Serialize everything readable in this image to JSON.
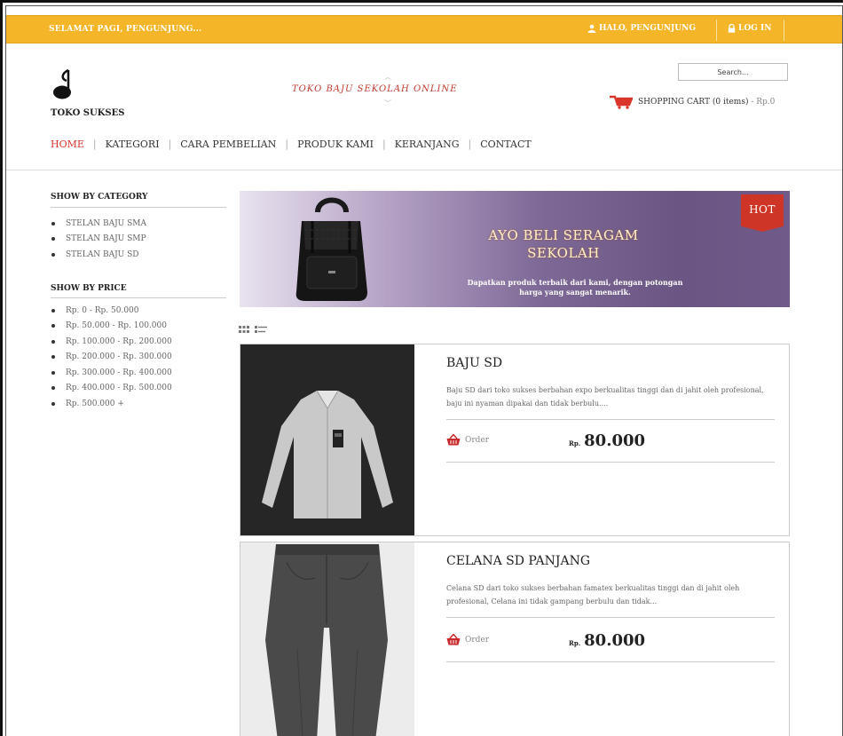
{
  "topbar": {
    "greeting": "SELAMAT PAGI, PENGUNJUNG...",
    "hello": "HALO, PENGUNJUNG",
    "login": "LOG IN",
    "bg_color": "#f5b529"
  },
  "header": {
    "store_name": "TOKO SUKSES",
    "tagline": "TOKO BAJU SEKOLAH ONLINE",
    "search_placeholder": "Search...",
    "cart_label": "SHOPPING CART",
    "cart_count": "(0 items)",
    "cart_total": "- Rp.0"
  },
  "nav": {
    "items": [
      {
        "label": "HOME",
        "active": true
      },
      {
        "label": "KATEGORI"
      },
      {
        "label": "CARA PEMBELIAN"
      },
      {
        "label": "PRODUK KAMI"
      },
      {
        "label": "KERANJANG"
      },
      {
        "label": "CONTACT"
      }
    ],
    "active_color": "#d9352b"
  },
  "sidebar": {
    "category_title": "SHOW BY CATEGORY",
    "categories": [
      "STELAN BAJU SMA",
      "STELAN BAJU SMP",
      "STELAN BAJU SD"
    ],
    "price_title": "SHOW BY PRICE",
    "prices": [
      "Rp. 0 - Rp. 50.000",
      "Rp. 50.000 - Rp. 100.000",
      "Rp. 100.000 - Rp. 200.000",
      "Rp. 200.000 - Rp. 300.000",
      "Rp. 300.000 - Rp. 400.000",
      "Rp. 400.000 - Rp. 500.000",
      "Rp. 500.000 +"
    ]
  },
  "banner": {
    "headline_line1": "AYO BELI SERAGAM",
    "headline_line2": "SEKOLAH",
    "sub_line1": "Dapatkan produk terbaik dari kami, dengan potongan",
    "sub_line2": "harga yang sangat menarik.",
    "badge": "HOT",
    "badge_color": "#cf3527"
  },
  "products": [
    {
      "title": "BAJU SD",
      "desc": "Baju SD dari toko sukses berbahan expo berkualitas tinggi dan di jahit oleh profesional, baju ini nyaman dipakai dan tidak berbulu....",
      "order_label": "Order",
      "currency": "Rp.",
      "price": "80.000"
    },
    {
      "title": "CELANA SD PANJANG",
      "desc": "Celana SD dari toko sukses berbahan famatex berkualitas tinggi dan di jahit oleh profesional, Celana ini tidak gampang berbulu dan tidak...",
      "order_label": "Order",
      "currency": "Rp.",
      "price": "80.000"
    }
  ],
  "icons": {
    "user": "user-icon",
    "lock": "lock-icon",
    "cart": "cart-icon",
    "grid_view": "grid-view-icon",
    "list_view": "list-view-icon",
    "basket": "basket-icon"
  }
}
